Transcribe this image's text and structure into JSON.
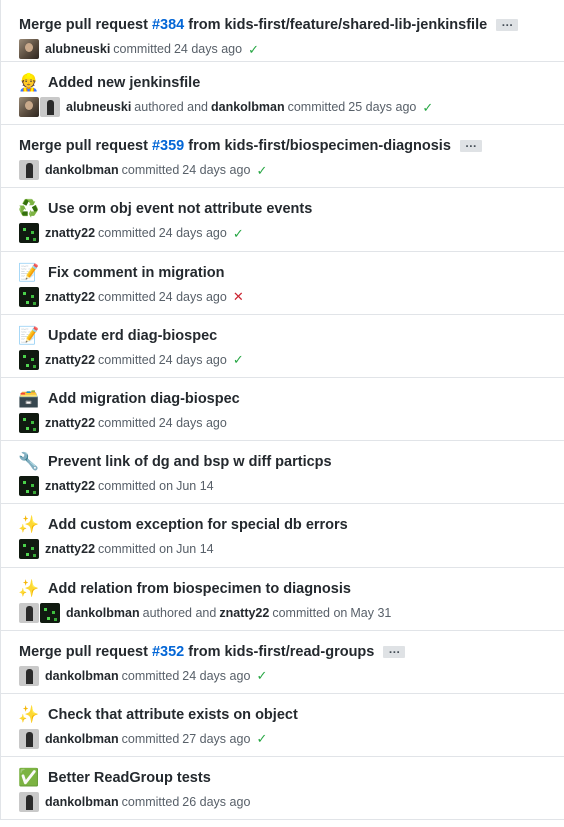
{
  "colors": {
    "link": "#0366d6",
    "success": "#28a745",
    "failure": "#cb2431",
    "muted": "#586069"
  },
  "commits": [
    {
      "icon": null,
      "title_prefix": "Merge pull request ",
      "pr": "#384",
      "title_suffix": " from kids-first/feature/shared-lib-jenkinsfile",
      "has_more": true,
      "more_label": "…",
      "avatars": [
        "alubneuski"
      ],
      "authors": [
        {
          "name": "alubneuski",
          "role": "committed"
        }
      ],
      "when": "24 days ago",
      "status": "success"
    },
    {
      "icon": "construction-worker-icon",
      "emoji": "👷",
      "title_prefix": "Added new jenkinsfile",
      "pr": "",
      "title_suffix": "",
      "has_more": false,
      "avatars": [
        "alubneuski",
        "dankolbman"
      ],
      "authors": [
        {
          "name": "alubneuski",
          "role": "authored and"
        },
        {
          "name": "dankolbman",
          "role": "committed"
        }
      ],
      "when": "25 days ago",
      "status": "success"
    },
    {
      "icon": null,
      "title_prefix": "Merge pull request ",
      "pr": "#359",
      "title_suffix": " from kids-first/biospecimen-diagnosis",
      "has_more": true,
      "more_label": "…",
      "avatars": [
        "dankolbman"
      ],
      "authors": [
        {
          "name": "dankolbman",
          "role": "committed"
        }
      ],
      "when": "24 days ago",
      "status": "success"
    },
    {
      "icon": "recycle-icon",
      "emoji": "♻️",
      "title_prefix": "Use orm obj event not attribute events",
      "pr": "",
      "title_suffix": "",
      "has_more": false,
      "avatars": [
        "znatty22"
      ],
      "authors": [
        {
          "name": "znatty22",
          "role": "committed"
        }
      ],
      "when": "24 days ago",
      "status": "success"
    },
    {
      "icon": "memo-icon",
      "emoji": "📝",
      "title_prefix": "Fix comment in migration",
      "pr": "",
      "title_suffix": "",
      "has_more": false,
      "avatars": [
        "znatty22"
      ],
      "authors": [
        {
          "name": "znatty22",
          "role": "committed"
        }
      ],
      "when": "24 days ago",
      "status": "failure"
    },
    {
      "icon": "memo-icon",
      "emoji": "📝",
      "title_prefix": "Update erd diag-biospec",
      "pr": "",
      "title_suffix": "",
      "has_more": false,
      "avatars": [
        "znatty22"
      ],
      "authors": [
        {
          "name": "znatty22",
          "role": "committed"
        }
      ],
      "when": "24 days ago",
      "status": "success"
    },
    {
      "icon": "card-file-box-icon",
      "emoji": "🗃️",
      "title_prefix": "Add migration diag-biospec",
      "pr": "",
      "title_suffix": "",
      "has_more": false,
      "avatars": [
        "znatty22"
      ],
      "authors": [
        {
          "name": "znatty22",
          "role": "committed"
        }
      ],
      "when": "24 days ago",
      "status": "none"
    },
    {
      "icon": "wrench-icon",
      "emoji": "🔧",
      "title_prefix": "Prevent link of dg and bsp w diff particps",
      "pr": "",
      "title_suffix": "",
      "has_more": false,
      "avatars": [
        "znatty22"
      ],
      "authors": [
        {
          "name": "znatty22",
          "role": "committed on"
        }
      ],
      "when": "Jun 14",
      "status": "none"
    },
    {
      "icon": "sparkles-icon",
      "emoji": "✨",
      "title_prefix": "Add custom exception for special db errors",
      "pr": "",
      "title_suffix": "",
      "has_more": false,
      "avatars": [
        "znatty22"
      ],
      "authors": [
        {
          "name": "znatty22",
          "role": "committed on"
        }
      ],
      "when": "Jun 14",
      "status": "none"
    },
    {
      "icon": "sparkles-icon",
      "emoji": "✨",
      "title_prefix": "Add relation from biospecimen to diagnosis",
      "pr": "",
      "title_suffix": "",
      "has_more": false,
      "avatars": [
        "dankolbman",
        "znatty22"
      ],
      "authors": [
        {
          "name": "dankolbman",
          "role": "authored and"
        },
        {
          "name": "znatty22",
          "role": "committed on"
        }
      ],
      "when": "May 31",
      "status": "none"
    },
    {
      "icon": null,
      "title_prefix": "Merge pull request ",
      "pr": "#352",
      "title_suffix": " from kids-first/read-groups",
      "has_more": true,
      "more_label": "…",
      "avatars": [
        "dankolbman"
      ],
      "authors": [
        {
          "name": "dankolbman",
          "role": "committed"
        }
      ],
      "when": "24 days ago",
      "status": "success"
    },
    {
      "icon": "sparkles-icon",
      "emoji": "✨",
      "title_prefix": "Check that attribute exists on object",
      "pr": "",
      "title_suffix": "",
      "has_more": false,
      "avatars": [
        "dankolbman"
      ],
      "authors": [
        {
          "name": "dankolbman",
          "role": "committed"
        }
      ],
      "when": "27 days ago",
      "status": "success"
    },
    {
      "icon": "check-mark-button-icon",
      "emoji": "✅",
      "title_prefix": "Better ReadGroup tests",
      "pr": "",
      "title_suffix": "",
      "has_more": false,
      "avatars": [
        "dankolbman"
      ],
      "authors": [
        {
          "name": "dankolbman",
          "role": "committed"
        }
      ],
      "when": "26 days ago",
      "status": "none"
    }
  ]
}
